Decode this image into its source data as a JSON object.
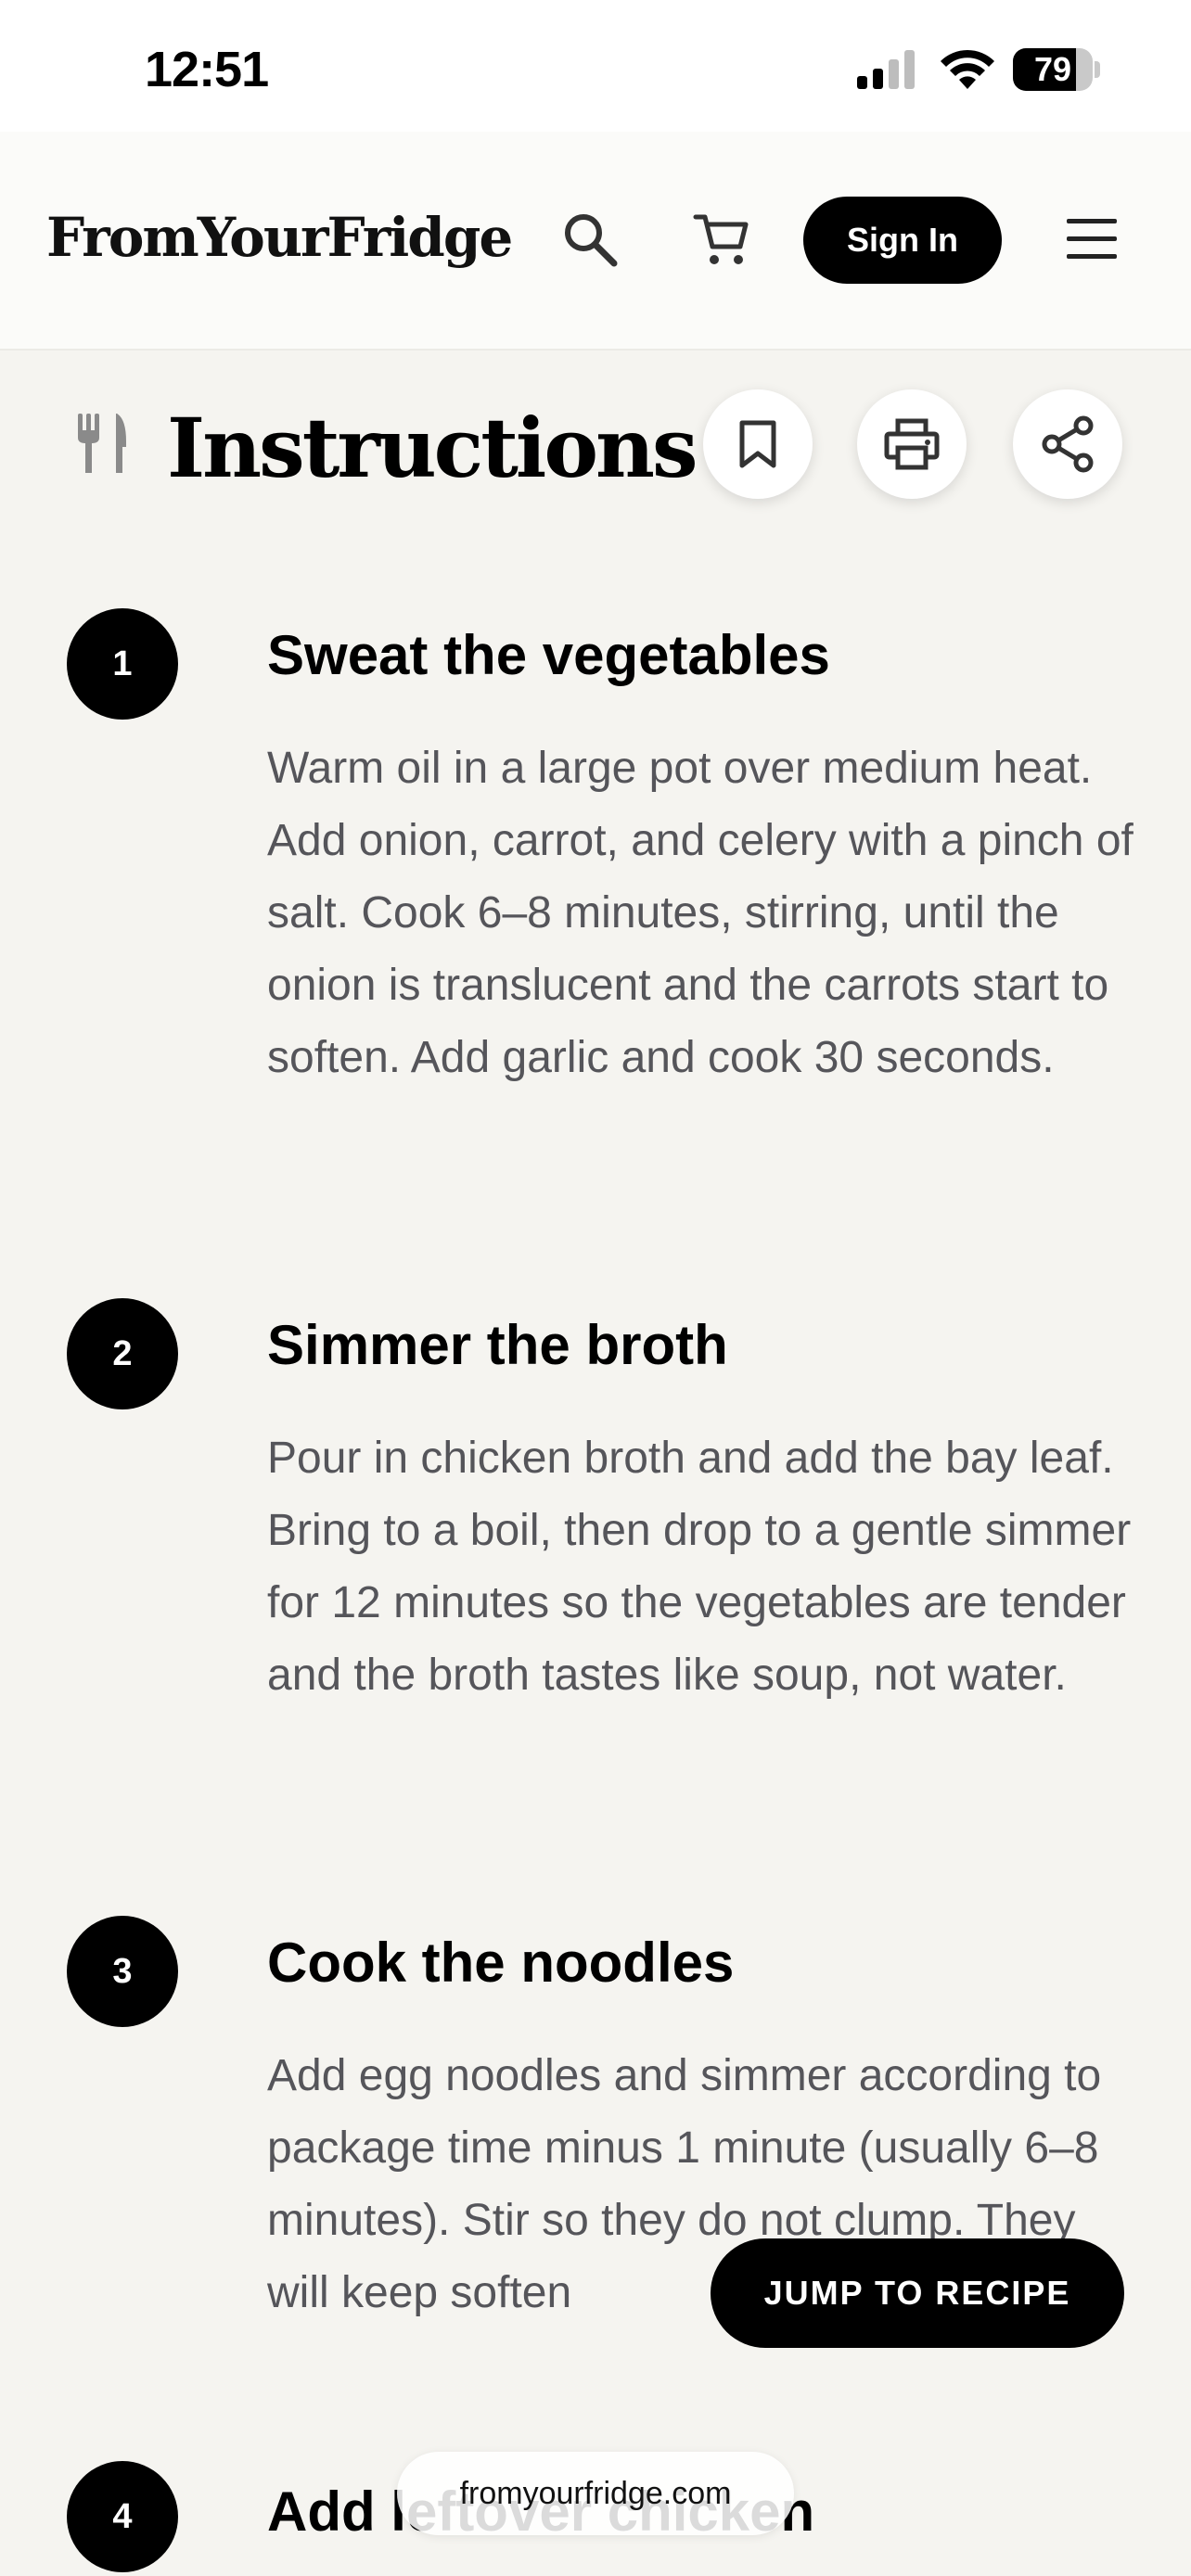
{
  "status_bar": {
    "time": "12:51",
    "battery": "79",
    "battery_level": 0.79
  },
  "header": {
    "logo": "FromYourFridge",
    "sign_in_label": "Sign In",
    "icons": [
      "search-icon",
      "cart-icon",
      "menu-icon"
    ]
  },
  "section": {
    "title": "Instructions",
    "icons": [
      "utensils-icon",
      "bookmark-icon",
      "print-icon",
      "share-icon"
    ]
  },
  "steps": [
    {
      "number": "1",
      "title": "Sweat the vegetables",
      "text": "Warm oil in a large pot over medium heat. Add onion, carrot, and celery with a pinch of salt. Cook 6–8 minutes, stirring, until the onion is translucent and the carrots start to soften. Add garlic and cook 30 seconds."
    },
    {
      "number": "2",
      "title": "Simmer the broth",
      "text": "Pour in chicken broth and add the bay leaf. Bring to a boil, then drop to a gentle simmer for 12 minutes so the vegetables are tender and the broth tastes like soup, not water."
    },
    {
      "number": "3",
      "title": "Cook the noodles",
      "text": "Add egg noodles and simmer according to package time minus 1 minute (usually 6–8 minutes). Stir so they do not clump. They will keep soften"
    },
    {
      "number": "4",
      "title": "Add leftover chicken"
    }
  ],
  "floating": {
    "jump_label": "JUMP TO RECIPE",
    "url": "fromyourfridge.com"
  },
  "colors": {
    "page_background": "#f5f4f0",
    "header_background": "#fbfbf9",
    "accent": "#000000",
    "body_text": "#55555a"
  }
}
